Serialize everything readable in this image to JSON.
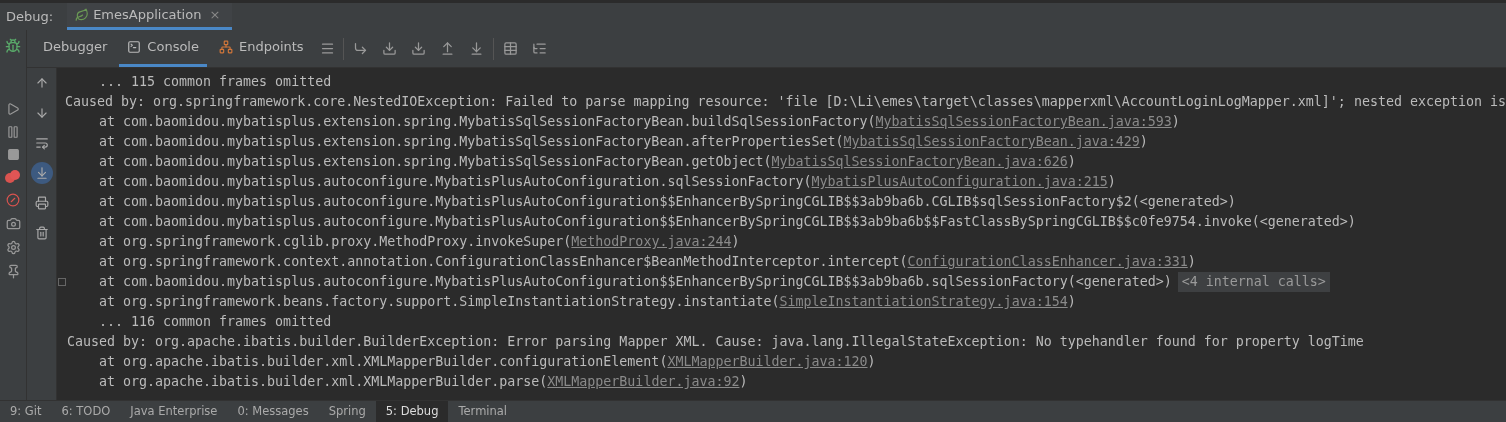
{
  "debug_bar": {
    "label": "Debug:",
    "tabs": [
      {
        "label": "EmesApplication",
        "selected": true,
        "close": "×"
      }
    ]
  },
  "toolbar": {
    "tabs": [
      {
        "label": "Debugger",
        "selected": false
      },
      {
        "label": "Console",
        "selected": true
      },
      {
        "label": "Endpoints",
        "selected": false
      }
    ]
  },
  "console_tools": [
    {
      "kind": "up",
      "on": false
    },
    {
      "kind": "down",
      "on": false
    },
    {
      "kind": "wrap",
      "on": false
    },
    {
      "kind": "scroll-end",
      "on": true
    },
    {
      "kind": "print",
      "on": false
    },
    {
      "kind": "trash",
      "on": false
    }
  ],
  "console": {
    "lines": [
      {
        "kind": "omitted",
        "text": "... 115 common frames omitted"
      },
      {
        "kind": "caused",
        "text": "Caused by: org.springframework.core.NestedIOException: Failed to parse mapping resource: 'file [D:\\Li\\emes\\target\\classes\\mapperxml\\AccountLoginLogMapper.xml]'; nested exception is"
      },
      {
        "kind": "frame",
        "text": "at com.baomidou.mybatisplus.extension.spring.MybatisSqlSessionFactoryBean.buildSqlSessionFactory(",
        "link": "MybatisSqlSessionFactoryBean.java:593",
        "tail": ")"
      },
      {
        "kind": "frame",
        "text": "at com.baomidou.mybatisplus.extension.spring.MybatisSqlSessionFactoryBean.afterPropertiesSet(",
        "link": "MybatisSqlSessionFactoryBean.java:429",
        "tail": ")"
      },
      {
        "kind": "frame",
        "text": "at com.baomidou.mybatisplus.extension.spring.MybatisSqlSessionFactoryBean.getObject(",
        "link": "MybatisSqlSessionFactoryBean.java:626",
        "tail": ")"
      },
      {
        "kind": "frame",
        "text": "at com.baomidou.mybatisplus.autoconfigure.MybatisPlusAutoConfiguration.sqlSessionFactory(",
        "link": "MybatisPlusAutoConfiguration.java:215",
        "tail": ")"
      },
      {
        "kind": "frame",
        "text": "at com.baomidou.mybatisplus.autoconfigure.MybatisPlusAutoConfiguration$$EnhancerBySpringCGLIB$$3ab9ba6b.CGLIB$sqlSessionFactory$2(<generated>)"
      },
      {
        "kind": "frame",
        "text": "at com.baomidou.mybatisplus.autoconfigure.MybatisPlusAutoConfiguration$$EnhancerBySpringCGLIB$$3ab9ba6b$$FastClassBySpringCGLIB$$c0fe9754.invoke(<generated>)"
      },
      {
        "kind": "frame",
        "text": "at org.springframework.cglib.proxy.MethodProxy.invokeSuper(",
        "link": "MethodProxy.java:244",
        "tail": ")"
      },
      {
        "kind": "frame",
        "text": "at org.springframework.context.annotation.ConfigurationClassEnhancer$BeanMethodInterceptor.intercept(",
        "link": "ConfigurationClassEnhancer.java:331",
        "tail": ")"
      },
      {
        "kind": "frame",
        "text": "at com.baomidou.mybatisplus.autoconfigure.MybatisPlusAutoConfiguration$$EnhancerBySpringCGLIB$$3ab9ba6b.sqlSessionFactory(<generated>)",
        "badge": "<4 internal calls>"
      },
      {
        "kind": "frame",
        "text": "at org.springframework.beans.factory.support.SimpleInstantiationStrategy.instantiate(",
        "link": "SimpleInstantiationStrategy.java:154",
        "tail": ")"
      },
      {
        "kind": "omitted",
        "text": "... 116 common frames omitted"
      },
      {
        "kind": "caused",
        "text": "Caused by: org.apache.ibatis.builder.BuilderException: Error parsing Mapper XML. Cause: java.lang.IllegalStateException: No typehandler found for property logTime"
      },
      {
        "kind": "frame",
        "text": "at org.apache.ibatis.builder.xml.XMLMapperBuilder.configurationElement(",
        "link": "XMLMapperBuilder.java:120",
        "tail": ")"
      },
      {
        "kind": "frame",
        "text": "at org.apache.ibatis.builder.xml.XMLMapperBuilder.parse(",
        "link": "XMLMapperBuilder.java:92",
        "tail": ")"
      }
    ]
  },
  "tool_windows": [
    {
      "label": "9: Git",
      "selected": false
    },
    {
      "label": "6: TODO",
      "selected": false
    },
    {
      "label": "Java Enterprise",
      "selected": false
    },
    {
      "label": "0: Messages",
      "selected": false
    },
    {
      "label": "Spring",
      "selected": false
    },
    {
      "label": "5: Debug",
      "selected": true
    },
    {
      "label": "Terminal",
      "selected": false
    }
  ]
}
